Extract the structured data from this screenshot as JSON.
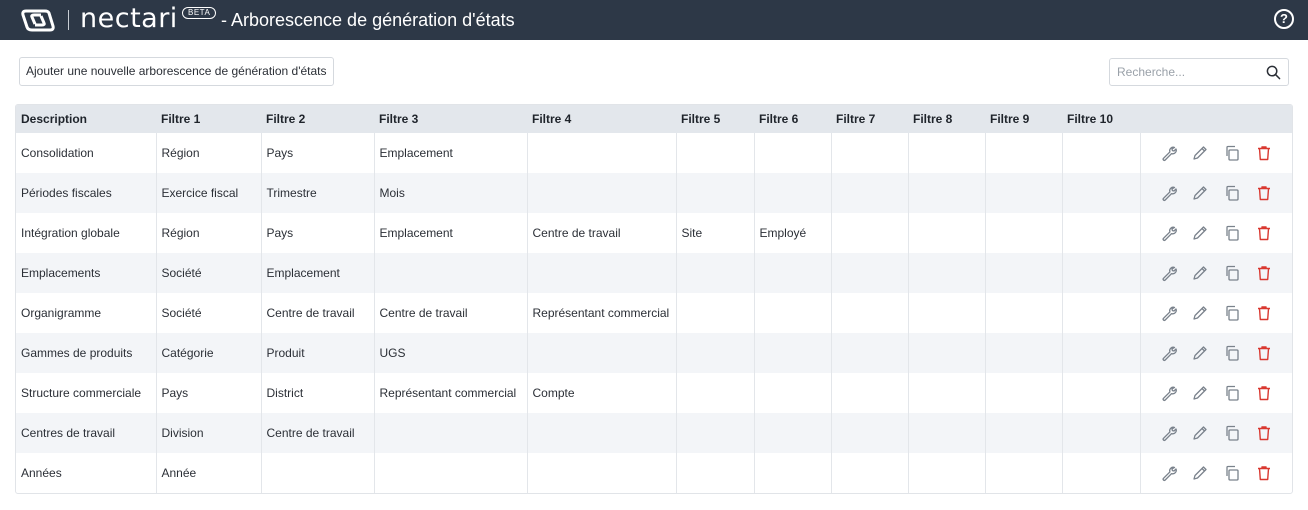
{
  "header": {
    "brand": "nectari",
    "badge": "BETA",
    "title": "- Arborescence de génération d'états",
    "help_symbol": "?"
  },
  "toolbar": {
    "add_label": "Ajouter une nouvelle arborescence de génération d'états",
    "search_placeholder": "Recherche..."
  },
  "table": {
    "columns": [
      "Description",
      "Filtre 1",
      "Filtre 2",
      "Filtre 3",
      "Filtre 4",
      "Filtre 5",
      "Filtre 6",
      "Filtre 7",
      "Filtre 8",
      "Filtre 9",
      "Filtre 10"
    ],
    "rows": [
      [
        "Consolidation",
        "Région",
        "Pays",
        "Emplacement",
        "",
        "",
        "",
        "",
        "",
        "",
        ""
      ],
      [
        "Périodes fiscales",
        "Exercice fiscal",
        "Trimestre",
        "Mois",
        "",
        "",
        "",
        "",
        "",
        "",
        ""
      ],
      [
        "Intégration globale",
        "Région",
        "Pays",
        "Emplacement",
        "Centre de travail",
        "Site",
        "Employé",
        "",
        "",
        "",
        ""
      ],
      [
        "Emplacements",
        "Société",
        "Emplacement",
        "",
        "",
        "",
        "",
        "",
        "",
        "",
        ""
      ],
      [
        "Organigramme",
        "Société",
        "Centre de travail",
        "Centre de travail",
        "Représentant commercial",
        "",
        "",
        "",
        "",
        "",
        ""
      ],
      [
        "Gammes de produits",
        "Catégorie",
        "Produit",
        "UGS",
        "",
        "",
        "",
        "",
        "",
        "",
        ""
      ],
      [
        "Structure commerciale",
        "Pays",
        "District",
        "Représentant commercial",
        "Compte",
        "",
        "",
        "",
        "",
        "",
        ""
      ],
      [
        "Centres de travail",
        "Division",
        "Centre de travail",
        "",
        "",
        "",
        "",
        "",
        "",
        "",
        ""
      ],
      [
        "Années",
        "Année",
        "",
        "",
        "",
        "",
        "",
        "",
        "",
        "",
        ""
      ]
    ],
    "row_actions": [
      "wrench-icon",
      "pencil-icon",
      "copy-icon",
      "trash-icon"
    ]
  },
  "colors": {
    "header_bg": "#2d3847",
    "delete_red": "#d9372f",
    "icon_gray": "#7a828c"
  }
}
